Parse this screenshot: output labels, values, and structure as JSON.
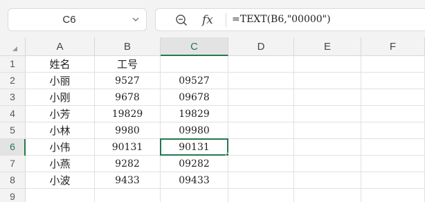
{
  "name_box": {
    "value": "C6"
  },
  "formula_bar": {
    "formula": "=TEXT(B6,\"00000\")",
    "fx_label": "fx"
  },
  "columns": [
    "A",
    "B",
    "C",
    "D",
    "E",
    "F"
  ],
  "active_column": "C",
  "rows": [
    "1",
    "2",
    "3",
    "4",
    "5",
    "6",
    "7",
    "8",
    "9"
  ],
  "active_row": "6",
  "sheet": {
    "headers": {
      "A": "姓名",
      "B": "工号",
      "C": ""
    },
    "data": [
      {
        "A": "小丽",
        "B": "9527",
        "C": "09527"
      },
      {
        "A": "小刚",
        "B": "9678",
        "C": "09678"
      },
      {
        "A": "小芳",
        "B": "19829",
        "C": "19829"
      },
      {
        "A": "小林",
        "B": "9980",
        "C": "09980"
      },
      {
        "A": "小伟",
        "B": "90131",
        "C": "90131"
      },
      {
        "A": "小燕",
        "B": "9282",
        "C": "09282"
      },
      {
        "A": "小波",
        "B": "9433",
        "C": "09433"
      }
    ]
  },
  "colors": {
    "accent": "#1f7a4d",
    "header_bg": "#f3f3f3",
    "grid_line": "#e0e0e0"
  }
}
